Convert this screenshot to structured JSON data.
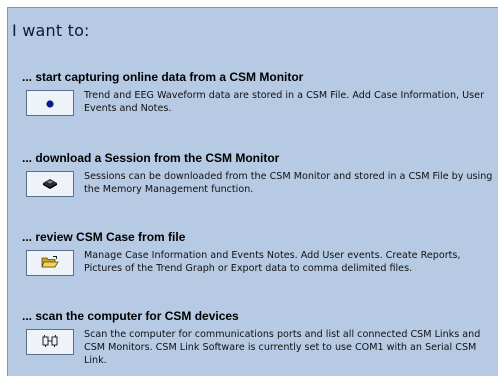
{
  "title": "I want to:",
  "options": [
    {
      "heading": "... start capturing online data from a CSM Monitor",
      "description": "Trend and EEG Waveform data are stored in a CSM File. Add Case Information, User Events and Notes.",
      "icon": "record-dot-icon"
    },
    {
      "heading": "... download a Session from the CSM Monitor",
      "description": "Sessions can be downloaded from the CSM Monitor and stored in a CSM File by using the Memory Management function.",
      "icon": "device-download-icon"
    },
    {
      "heading": "... review CSM Case from file",
      "description": "Manage Case Information and Events Notes. Add User events. Create Reports, Pictures of the Trend Graph or Export data to comma delimited files.",
      "icon": "open-folder-icon"
    },
    {
      "heading": "... scan the computer for CSM devices",
      "description": "Scan the computer for communications ports and list all connected CSM Links and CSM Monitors. CSM Link Software is currently set to use COM1 with an Serial CSM Link.",
      "icon": "scan-devices-icon"
    }
  ],
  "colors": {
    "panel_background": "#b7cae3",
    "button_background": "#eef3fa",
    "record_dot": "#0a1a8a"
  }
}
